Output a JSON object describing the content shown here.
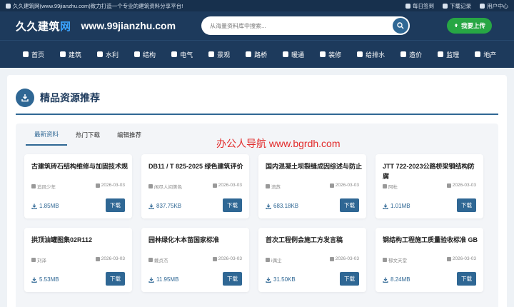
{
  "topbar": {
    "notice": "久久建筑网(www.99jianzhu.com)致力打造一个专业的建筑资料分享平台!",
    "checkin": "每日签到",
    "history": "下载记录",
    "user_center": "用户中心"
  },
  "header": {
    "logo_main": "久久建筑",
    "logo_accent": "网",
    "domain": "www.99jianzhu.com",
    "search_placeholder": "从海量资料库中搜索...",
    "upload_label": "我要上传"
  },
  "nav": [
    {
      "label": "首页",
      "icon": "home-icon"
    },
    {
      "label": "建筑",
      "icon": "building-icon"
    },
    {
      "label": "水利",
      "icon": "water-icon"
    },
    {
      "label": "结构",
      "icon": "structure-icon"
    },
    {
      "label": "电气",
      "icon": "bolt-icon"
    },
    {
      "label": "景观",
      "icon": "tree-icon"
    },
    {
      "label": "路桥",
      "icon": "road-icon"
    },
    {
      "label": "暖通",
      "icon": "hvac-icon"
    },
    {
      "label": "装修",
      "icon": "paint-icon"
    },
    {
      "label": "给排水",
      "icon": "pipe-icon"
    },
    {
      "label": "造价",
      "icon": "price-icon"
    },
    {
      "label": "监理",
      "icon": "inspect-icon"
    },
    {
      "label": "地产",
      "icon": "estate-icon"
    }
  ],
  "section": {
    "title": "精品资源推荐",
    "tabs": [
      "最新资料",
      "热门下载",
      "编辑推荐"
    ],
    "active_tab": 0,
    "watermark": "办公人导航  www.bgrdh.com"
  },
  "cards": [
    {
      "title": "古建筑砖石结构维修与加固技术规",
      "author": "追风少年",
      "date": "2026-03-03",
      "size": "1.85MB",
      "download": "下载"
    },
    {
      "title": "DB11 / T 825-2025 绿色建筑评价",
      "author": "闲尽人间美色",
      "date": "2026-03-03",
      "size": "837.75KB",
      "download": "下载"
    },
    {
      "title": "国内混凝土坝裂缝成因综述与防止",
      "author": "流苏",
      "date": "2026-03-03",
      "size": "683.18KB",
      "download": "下载"
    },
    {
      "title": "JTT 722-2023公路桥梁钢结构防腐",
      "author": "阿杜",
      "date": "2026-03-03",
      "size": "1.01MB",
      "download": "下载"
    },
    {
      "title": "拱顶油罐图集02R112",
      "author": "刘泽",
      "date": "2026-03-03",
      "size": "5.53MB",
      "download": "下载"
    },
    {
      "title": "园林绿化木本苗国家标准",
      "author": "戴贞杰",
      "date": "2026-03-03",
      "size": "11.95MB",
      "download": "下载"
    },
    {
      "title": "首次工程例会施工方发言稿",
      "author": "i偶尘",
      "date": "2026-03-03",
      "size": "31.50KB",
      "download": "下载"
    },
    {
      "title": "钢结构工程施工质量验收标准 GB",
      "author": "郁文天堂",
      "date": "2026-03-03",
      "size": "8.24MB",
      "download": "下载"
    }
  ],
  "colors": {
    "navy": "#1d3a5c",
    "topbar": "#17304d",
    "accent": "#2f6794",
    "upload_green": "#27a644",
    "watermark_red": "#e22a2a"
  }
}
